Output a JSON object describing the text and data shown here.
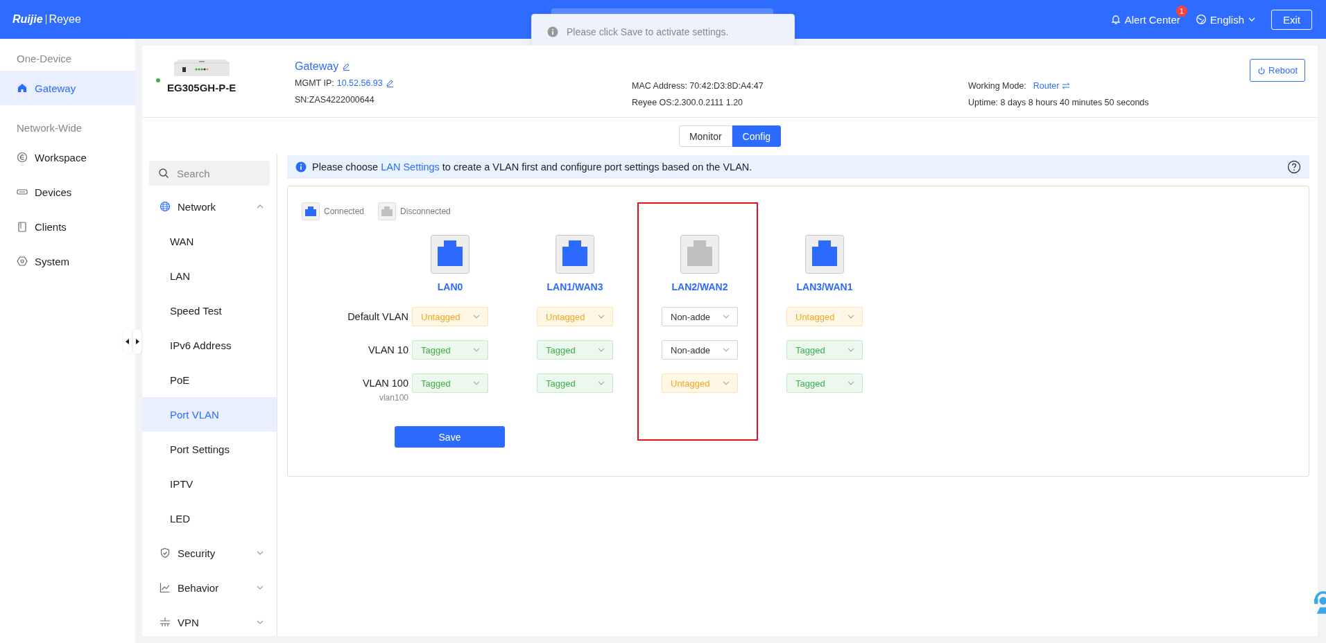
{
  "header": {
    "brand": "Ruijie",
    "product": "Reyee",
    "alert_center": {
      "label": "Alert Center",
      "badge": "1"
    },
    "language": "English",
    "exit": "Exit"
  },
  "toast": {
    "message": "Please click Save to activate settings."
  },
  "sidebar": [
    {
      "title": "One-Device",
      "items": [
        {
          "label": "Gateway",
          "selected": true
        }
      ]
    },
    {
      "title": "Network-Wide",
      "items": [
        {
          "label": "Workspace",
          "selected": false
        },
        {
          "label": "Devices",
          "selected": false
        },
        {
          "label": "Clients",
          "selected": false
        },
        {
          "label": "System",
          "selected": false
        }
      ]
    }
  ],
  "device": {
    "online": true,
    "model": "EG305GH-P-E",
    "name": "Gateway",
    "mgmt_ip_label": "MGMT IP:",
    "mgmt_ip": "10.52.56.93",
    "sn": "SN:ZAS4222000644",
    "mac": "MAC Address: 70:42:D3:8D:A4:47",
    "os": "Reyee OS:2.300.0.2111 1.20",
    "working_mode_label": "Working Mode:",
    "working_mode": "Router",
    "uptime": "Uptime: 8 days 8 hours 40 minutes 50 seconds",
    "reboot": "Reboot"
  },
  "view_tabs": [
    {
      "label": "Monitor",
      "selected": false
    },
    {
      "label": "Config",
      "selected": true
    }
  ],
  "menu": {
    "search_placeholder": "Search",
    "items": [
      {
        "label": "Network",
        "expanded": true,
        "children": [
          {
            "label": "WAN",
            "selected": false
          },
          {
            "label": "LAN",
            "selected": false
          },
          {
            "label": "Speed Test",
            "selected": false
          },
          {
            "label": "IPv6 Address",
            "selected": false
          },
          {
            "label": "PoE",
            "selected": false
          },
          {
            "label": "Port VLAN",
            "selected": true
          },
          {
            "label": "Port Settings",
            "selected": false
          },
          {
            "label": "IPTV",
            "selected": false
          },
          {
            "label": "LED",
            "selected": false
          }
        ]
      },
      {
        "label": "Security",
        "expanded": false
      },
      {
        "label": "Behavior",
        "expanded": false
      },
      {
        "label": "VPN",
        "expanded": false
      }
    ]
  },
  "notice": {
    "before": "Please choose ",
    "link": "LAN Settings",
    "after": " to create a VLAN first and configure port settings based on the VLAN."
  },
  "legend": [
    {
      "label": "Connected",
      "connected": true
    },
    {
      "label": "Disconnected",
      "connected": false
    }
  ],
  "ports": [
    {
      "name": "LAN0",
      "connected": true,
      "highlighted": false
    },
    {
      "name": "LAN1/WAN3",
      "connected": true,
      "highlighted": false
    },
    {
      "name": "LAN2/WAN2",
      "connected": false,
      "highlighted": true
    },
    {
      "name": "LAN3/WAN1",
      "connected": true,
      "highlighted": false
    }
  ],
  "vlans": [
    {
      "name": "Default VLAN",
      "cells": [
        {
          "text": "Untagged",
          "kind": "untagged"
        },
        {
          "text": "Untagged",
          "kind": "untagged"
        },
        {
          "text": "Non-adde",
          "kind": "none"
        },
        {
          "text": "Untagged",
          "kind": "untagged"
        }
      ]
    },
    {
      "name": "VLAN 10",
      "cells": [
        {
          "text": "Tagged",
          "kind": "tagged"
        },
        {
          "text": "Tagged",
          "kind": "tagged"
        },
        {
          "text": "Non-adde",
          "kind": "none"
        },
        {
          "text": "Tagged",
          "kind": "tagged"
        }
      ]
    },
    {
      "name": "VLAN 100",
      "remark": "vlan100",
      "cells": [
        {
          "text": "Tagged",
          "kind": "tagged"
        },
        {
          "text": "Tagged",
          "kind": "tagged"
        },
        {
          "text": "Untagged",
          "kind": "untagged"
        },
        {
          "text": "Tagged",
          "kind": "tagged"
        }
      ]
    }
  ],
  "save": "Save"
}
